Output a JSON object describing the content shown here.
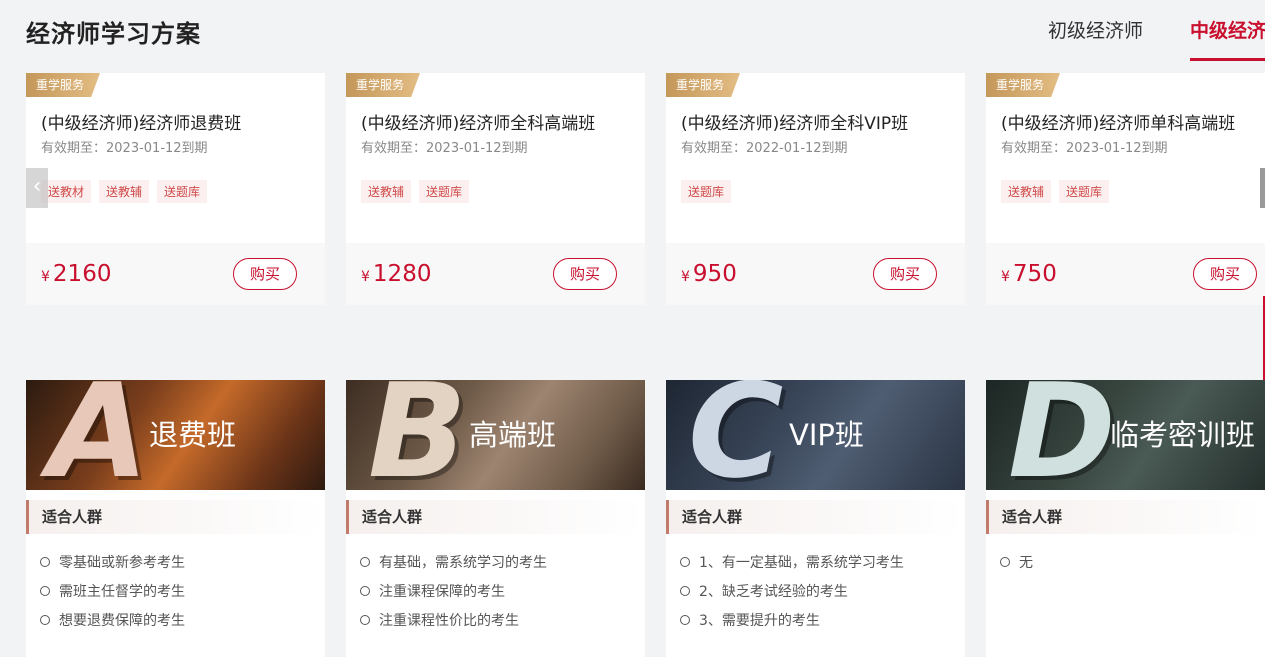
{
  "header": {
    "title": "经济师学习方案",
    "tabs": [
      {
        "label": "初级经济师",
        "active": false
      },
      {
        "label": "中级经济",
        "active": true
      }
    ]
  },
  "colors": {
    "accent": "#c8102e",
    "badge": "#c4975a"
  },
  "products": [
    {
      "badge": "重学服务",
      "name": "(中级经济师)经济师退费班",
      "valid": "有效期至：2023-01-12到期",
      "tags": [
        "送教材",
        "送教辅",
        "送题库"
      ],
      "currency": "¥",
      "price": "2160",
      "buy": "购买"
    },
    {
      "badge": "重学服务",
      "name": "(中级经济师)经济师全科高端班",
      "valid": "有效期至：2023-01-12到期",
      "tags": [
        "送教辅",
        "送题库"
      ],
      "currency": "¥",
      "price": "1280",
      "buy": "购买"
    },
    {
      "badge": "重学服务",
      "name": "(中级经济师)经济师全科VIP班",
      "valid": "有效期至：2022-01-12到期",
      "tags": [
        "送题库"
      ],
      "currency": "¥",
      "price": "950",
      "buy": "购买"
    },
    {
      "badge": "重学服务",
      "name": "(中级经济师)经济师单科高端班",
      "valid": "有效期至：2023-01-12到期",
      "tags": [
        "送教辅",
        "送题库"
      ],
      "currency": "¥",
      "price": "750",
      "buy": "购买"
    }
  ],
  "carousel": {
    "prev_icon": "chevron-left-icon"
  },
  "plans": [
    {
      "letter": "A",
      "name": "退费班",
      "audience_title": "适合人群",
      "audience": [
        "零基础或新参考考生",
        "需班主任督学的考生",
        "想要退费保障的考生"
      ]
    },
    {
      "letter": "B",
      "name": "高端班",
      "audience_title": "适合人群",
      "audience": [
        "有基础，需系统学习的考生",
        "注重课程保障的考生",
        "注重课程性价比的考生"
      ]
    },
    {
      "letter": "C",
      "name": "VIP班",
      "audience_title": "适合人群",
      "audience": [
        "1、有一定基础，需系统学习考生",
        "2、缺乏考试经验的考生",
        "3、需要提升的考生"
      ]
    },
    {
      "letter": "D",
      "name": "临考密训班",
      "audience_title": "适合人群",
      "audience": [
        "无"
      ]
    }
  ]
}
